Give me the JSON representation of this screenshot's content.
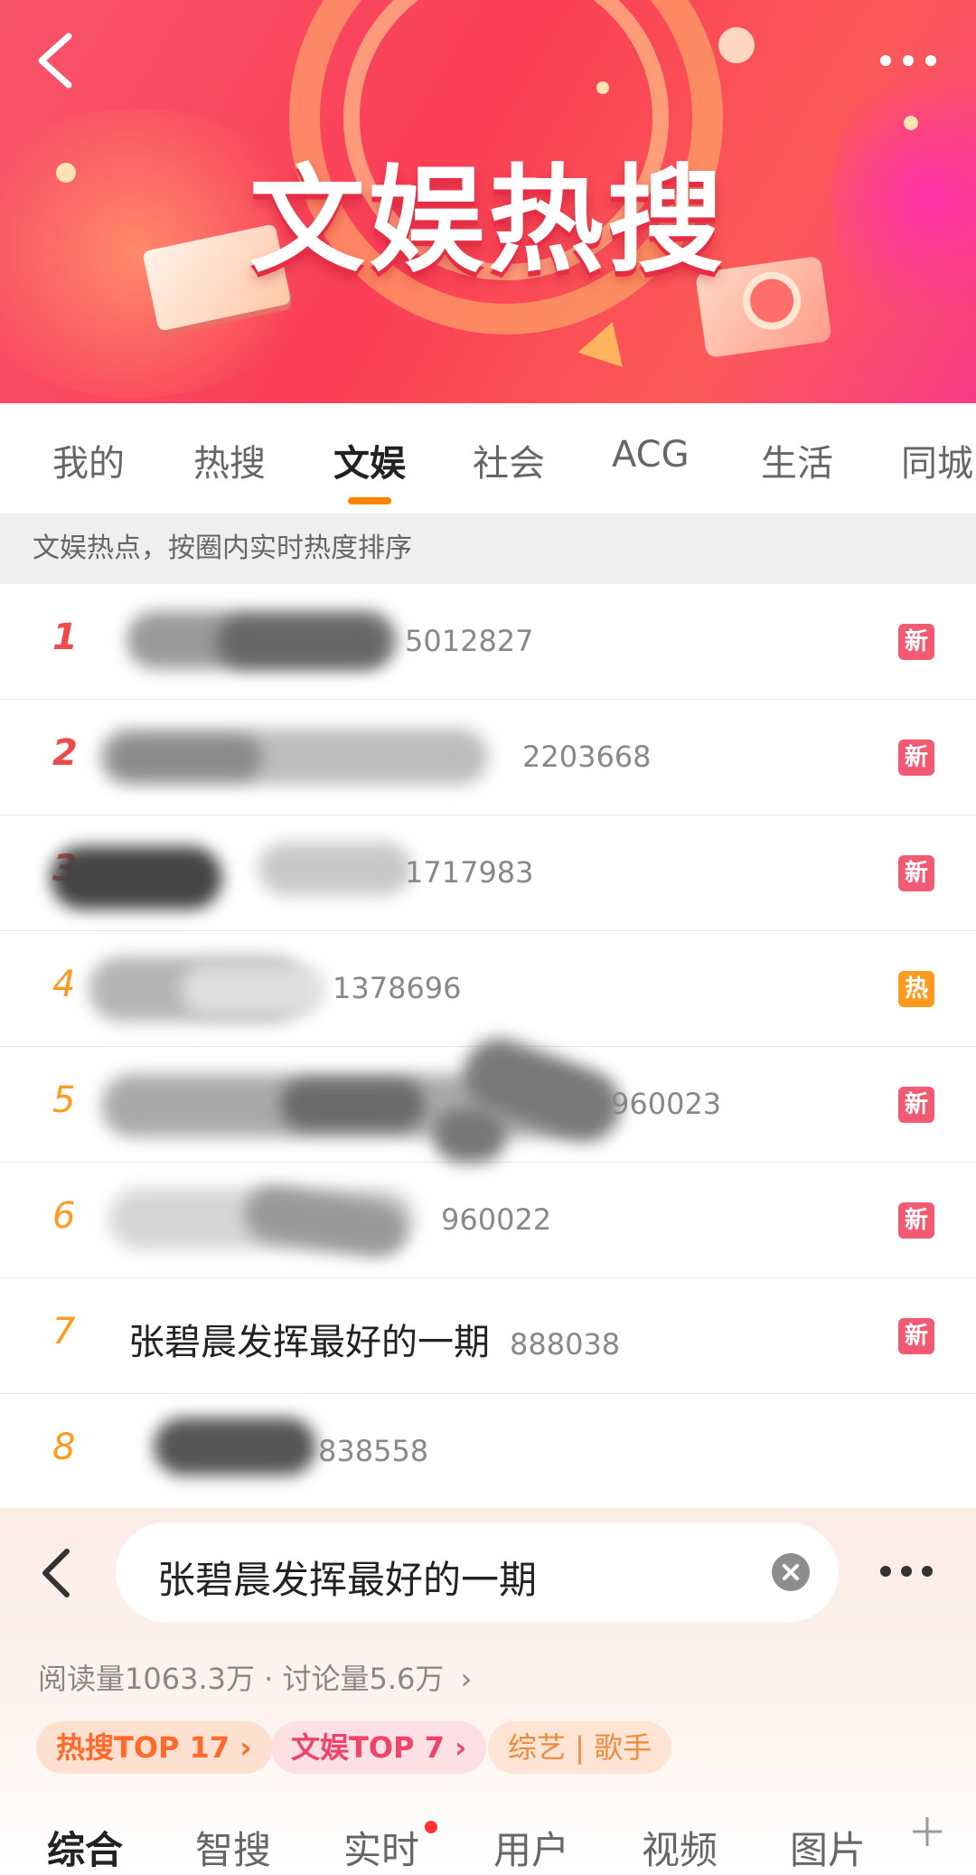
{
  "banner": {
    "title": "文娱热搜",
    "back_icon": "chevron-left-icon",
    "more_icon": "more-dots-icon",
    "colors": {
      "bg_start": "#f8546a",
      "bg_end": "#f93c86"
    }
  },
  "tabs": [
    {
      "label": "我的"
    },
    {
      "label": "热搜"
    },
    {
      "label": "文娱",
      "active": true
    },
    {
      "label": "社会"
    },
    {
      "label": "ACG"
    },
    {
      "label": "生活"
    },
    {
      "label": "同城"
    }
  ],
  "subhead": "文娱热点，按圈内实时热度排序",
  "list": [
    {
      "rank": "1",
      "heat": "5012827",
      "badge": "新"
    },
    {
      "rank": "2",
      "heat": "2203668",
      "badge": "新"
    },
    {
      "rank": "3",
      "heat": "1717983",
      "badge": "新"
    },
    {
      "rank": "4",
      "heat": "1378696",
      "badge": "热"
    },
    {
      "rank": "5",
      "heat": "960023",
      "badge": "新"
    },
    {
      "rank": "6",
      "heat": "960022",
      "badge": "新"
    },
    {
      "rank": "7",
      "title": "张碧晨发挥最好的一期",
      "heat": "888038",
      "badge": "新"
    },
    {
      "rank": "8",
      "heat": "838558"
    }
  ],
  "search_panel": {
    "query": "张碧晨发挥最好的一期",
    "stats": "阅读量1063.3万 · 讨论量5.6万",
    "chips": [
      "热搜TOP 17",
      "文娱TOP 7",
      "综艺 | 歌手"
    ],
    "tabs": [
      "综合",
      "智搜",
      "实时",
      "用户",
      "视频",
      "图片"
    ],
    "active_tab": "综合",
    "accent": "#ff8200"
  }
}
